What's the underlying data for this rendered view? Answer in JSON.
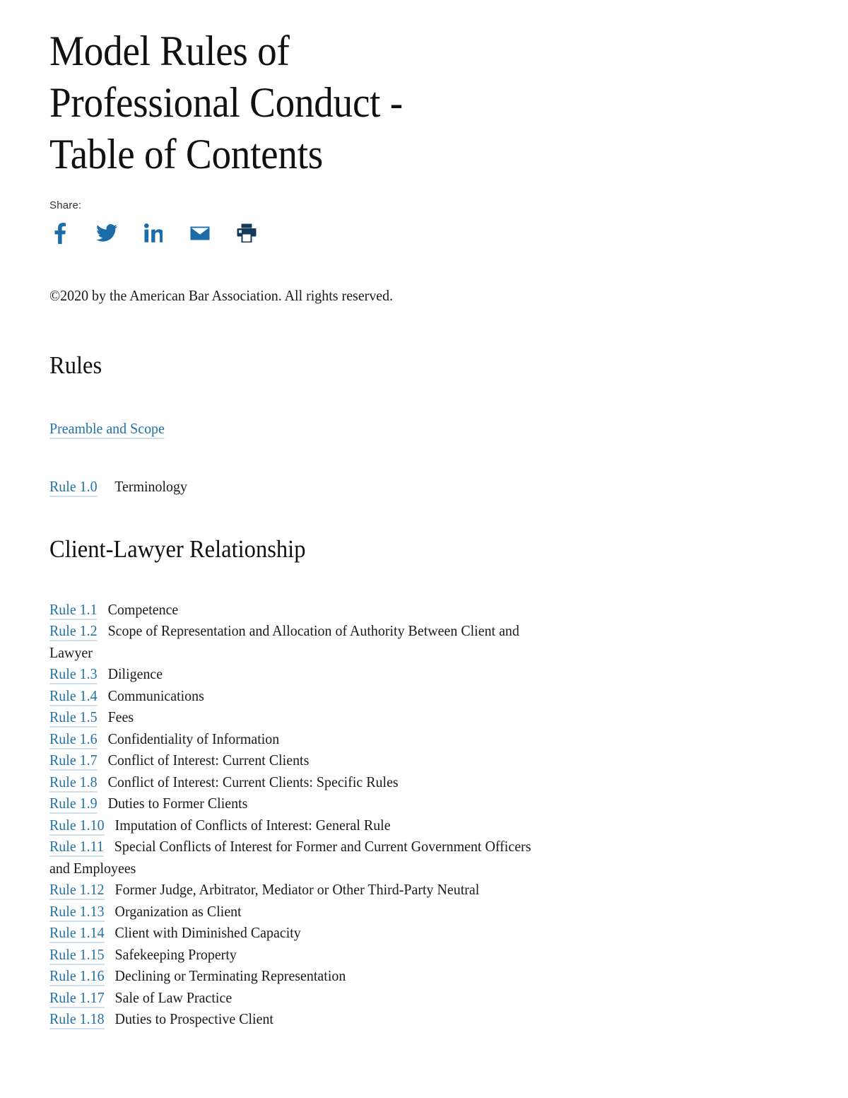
{
  "page": {
    "title": "Model Rules of Professional Conduct - Table of Contents",
    "copyright": "©2020 by the American Bar Association. All rights reserved."
  },
  "share": {
    "label": "Share:",
    "items": [
      {
        "name": "facebook",
        "icon": "facebook-icon"
      },
      {
        "name": "twitter",
        "icon": "twitter-icon"
      },
      {
        "name": "linkedin",
        "icon": "linkedin-icon"
      },
      {
        "name": "email",
        "icon": "email-icon"
      },
      {
        "name": "print",
        "icon": "print-icon"
      }
    ]
  },
  "sections": [
    {
      "heading": "Rules",
      "preamble_link": "Preamble and Scope",
      "rule_zero": {
        "link": "Rule 1.0",
        "title": "Terminology"
      }
    },
    {
      "heading": "Client-Lawyer Relationship",
      "rules": [
        {
          "link": "Rule 1.1",
          "title": "Competence"
        },
        {
          "link": "Rule 1.2",
          "title": "Scope of Representation and Allocation of Authority Between Client and Lawyer"
        },
        {
          "link": "Rule 1.3",
          "title": "Diligence"
        },
        {
          "link": "Rule 1.4",
          "title": "Communications"
        },
        {
          "link": "Rule 1.5",
          "title": "Fees"
        },
        {
          "link": "Rule 1.6",
          "title": "Confidentiality of Information"
        },
        {
          "link": "Rule 1.7",
          "title": "Conflict of Interest: Current Clients"
        },
        {
          "link": "Rule 1.8",
          "title": "Conflict of Interest: Current Clients: Specific Rules"
        },
        {
          "link": "Rule 1.9",
          "title": "Duties to Former Clients"
        },
        {
          "link": "Rule 1.10",
          "title": "Imputation of Conflicts of Interest: General Rule"
        },
        {
          "link": "Rule 1.11",
          "title": "Special Conflicts of Interest for Former and Current Government Officers and Employees"
        },
        {
          "link": "Rule 1.12",
          "title": "Former Judge, Arbitrator, Mediator or Other Third-Party Neutral"
        },
        {
          "link": "Rule 1.13",
          "title": "Organization as Client"
        },
        {
          "link": "Rule 1.14",
          "title": "Client with Diminished Capacity"
        },
        {
          "link": "Rule 1.15",
          "title": "Safekeeping Property"
        },
        {
          "link": "Rule 1.16",
          "title": "Declining or Terminating Representation"
        },
        {
          "link": "Rule 1.17",
          "title": "Sale of Law Practice"
        },
        {
          "link": "Rule 1.18",
          "title": "Duties to Prospective Client"
        }
      ]
    }
  ],
  "colors": {
    "link": "#2272a8",
    "link_underline": "#cfe0ec",
    "icon_blue": "#1b6ca8",
    "icon_navy": "#13395b",
    "text": "#1a1a1a"
  }
}
